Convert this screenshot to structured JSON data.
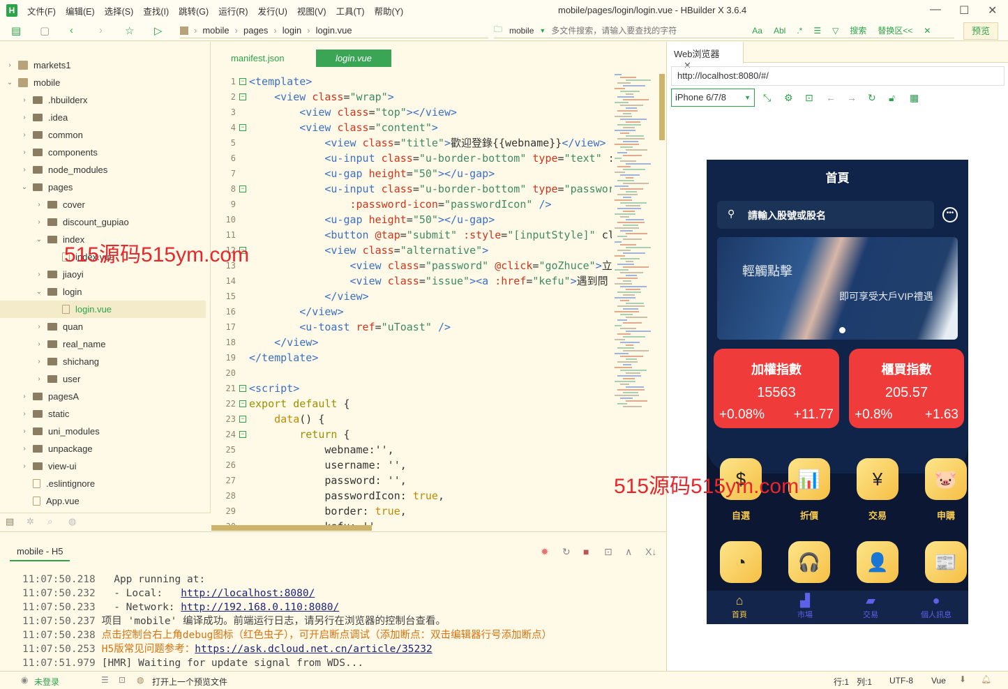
{
  "app": {
    "logo": "H",
    "title": "mobile/pages/login/login.vue - HBuilder X 3.6.4",
    "menu": [
      "文件(F)",
      "编辑(E)",
      "选择(S)",
      "查找(I)",
      "跳转(G)",
      "运行(R)",
      "发行(U)",
      "视图(V)",
      "工具(T)",
      "帮助(Y)"
    ]
  },
  "toolbar": {
    "breadcrumb": [
      "mobile",
      "pages",
      "login",
      "login.vue"
    ],
    "search_scope": "mobile",
    "search_placeholder": "多文件搜索，请输入要查找的字符",
    "search_label": "搜索",
    "replace_label": "替换区<<",
    "preview_label": "预览",
    "opt_case": "Aa",
    "opt_word": "Abl",
    "opt_regex": ".*"
  },
  "sidebar": {
    "items": [
      {
        "label": "markets1",
        "depth": 0,
        "type": "proj",
        "open": false
      },
      {
        "label": "mobile",
        "depth": 0,
        "type": "proj",
        "open": true
      },
      {
        "label": ".hbuilderx",
        "depth": 1,
        "type": "folder",
        "open": false
      },
      {
        "label": ".idea",
        "depth": 1,
        "type": "folder",
        "open": false
      },
      {
        "label": "common",
        "depth": 1,
        "type": "folder",
        "open": false
      },
      {
        "label": "components",
        "depth": 1,
        "type": "folder",
        "open": false
      },
      {
        "label": "node_modules",
        "depth": 1,
        "type": "folder",
        "open": false
      },
      {
        "label": "pages",
        "depth": 1,
        "type": "folder",
        "open": true
      },
      {
        "label": "cover",
        "depth": 2,
        "type": "folder",
        "open": false
      },
      {
        "label": "discount_gupiao",
        "depth": 2,
        "type": "folder",
        "open": false
      },
      {
        "label": "index",
        "depth": 2,
        "type": "folder",
        "open": true
      },
      {
        "label": "index.vue",
        "depth": 3,
        "type": "file"
      },
      {
        "label": "jiaoyi",
        "depth": 2,
        "type": "folder",
        "open": false
      },
      {
        "label": "login",
        "depth": 2,
        "type": "folder",
        "open": true
      },
      {
        "label": "login.vue",
        "depth": 3,
        "type": "file",
        "selected": true
      },
      {
        "label": "quan",
        "depth": 2,
        "type": "folder",
        "open": false
      },
      {
        "label": "real_name",
        "depth": 2,
        "type": "folder",
        "open": false
      },
      {
        "label": "shichang",
        "depth": 2,
        "type": "folder",
        "open": false
      },
      {
        "label": "user",
        "depth": 2,
        "type": "folder",
        "open": false
      },
      {
        "label": "pagesA",
        "depth": 1,
        "type": "folder",
        "open": false
      },
      {
        "label": "static",
        "depth": 1,
        "type": "folder",
        "open": false
      },
      {
        "label": "uni_modules",
        "depth": 1,
        "type": "folder",
        "open": false
      },
      {
        "label": "unpackage",
        "depth": 1,
        "type": "folder",
        "open": false
      },
      {
        "label": "view-ui",
        "depth": 1,
        "type": "folder",
        "open": false
      },
      {
        "label": ".eslintignore",
        "depth": 1,
        "type": "file"
      },
      {
        "label": "App.vue",
        "depth": 1,
        "type": "file"
      }
    ]
  },
  "editor": {
    "tabs": [
      {
        "label": "manifest.json",
        "active": false
      },
      {
        "label": "login.vue",
        "active": true
      }
    ],
    "fold_lines": [
      1,
      2,
      4,
      8,
      12,
      21,
      22,
      23,
      24
    ],
    "lines": [
      "<template>",
      "    <view class=\"wrap\">",
      "        <view class=\"top\"></view>",
      "        <view class=\"content\">",
      "            <view class=\"title\">歡迎登錄{{webname}}</view>",
      "            <u-input class=\"u-border-bottom\" type=\"text\" :",
      "            <u-gap height=\"50\"></u-gap>",
      "            <u-input class=\"u-border-bottom\" type=\"passwor",
      "                :password-icon=\"passwordIcon\" />",
      "            <u-gap height=\"50\"></u-gap>",
      "            <button @tap=\"submit\" :style=\"[inputStyle]\" cl",
      "            <view class=\"alternative\">",
      "                <view class=\"password\" @click=\"goZhuce\">立",
      "                <view class=\"issue\"><a :href=\"kefu\">遇到問",
      "            </view>",
      "        </view>",
      "        <u-toast ref=\"uToast\" />",
      "    </view>",
      "</template>",
      "",
      "<script>",
      "export default {",
      "    data() {",
      "        return {",
      "            webname:'',",
      "            username: '',",
      "            password: '',",
      "            passwordIcon: true,",
      "            border: true,",
      "            kefu: ''"
    ]
  },
  "watermark": "515源码515ym.com",
  "console": {
    "tab": "mobile - H5",
    "lines": [
      {
        "ts": "11:07:50.218",
        "text": "  App running at:"
      },
      {
        "ts": "11:07:50.232",
        "text": "  - Local:   ",
        "link": "http://localhost:8080/"
      },
      {
        "ts": "11:07:50.233",
        "text": "  - Network: ",
        "link": "http://192.168.0.110:8080/"
      },
      {
        "ts": "11:07:50.237",
        "text": "项目 'mobile' 编译成功。前端运行日志，请另行在浏览器的控制台查看。"
      },
      {
        "ts": "11:07:50.238",
        "text": "点击控制台右上角debug图标（红色虫子），可开启断点调试（添加断点：双击编辑器行号添加断点）",
        "warn": true
      },
      {
        "ts": "11:07:50.253",
        "text": "H5版常见问题参考：",
        "link": "https://ask.dcloud.net.cn/article/35232",
        "warn": true
      },
      {
        "ts": "11:07:51.979",
        "text": "[HMR] Waiting for update signal from WDS..."
      }
    ]
  },
  "browser": {
    "tab": "Web浏览器",
    "url": "http://localhost:8080/#/",
    "device": "iPhone 6/7/8"
  },
  "phone": {
    "title": "首頁",
    "search_placeholder": "請輸入股號或股名",
    "banner_text1": "輕觸點擊",
    "banner_text2": "即可享受大戶VIP禮遇",
    "cards": [
      {
        "title": "加權指數",
        "value": "15563",
        "pct": "+0.08%",
        "chg": "+11.77"
      },
      {
        "title": "櫃買指數",
        "value": "205.57",
        "pct": "+0.8%",
        "chg": "+1.63"
      }
    ],
    "grid": [
      {
        "label": "自選",
        "icon": "money-bag-icon",
        "glyph": "$"
      },
      {
        "label": "折價",
        "icon": "bar-chart-icon",
        "glyph": "📊"
      },
      {
        "label": "交易",
        "icon": "yen-exchange-icon",
        "glyph": "¥"
      },
      {
        "label": "申購",
        "icon": "piggy-bank-icon",
        "glyph": "🐷"
      },
      {
        "label": "",
        "icon": "pie-chart-icon",
        "glyph": "◔"
      },
      {
        "label": "",
        "icon": "customer-service-icon",
        "glyph": "🎧"
      },
      {
        "label": "",
        "icon": "user-icon",
        "glyph": "👤"
      },
      {
        "label": "",
        "icon": "news-icon",
        "glyph": "📰"
      }
    ],
    "nav": [
      {
        "label": "首頁",
        "icon": "home-icon",
        "glyph": "⌂",
        "active": true
      },
      {
        "label": "市場",
        "icon": "market-chart-icon",
        "glyph": "▟"
      },
      {
        "label": "交易",
        "icon": "wallet-icon",
        "glyph": "▰"
      },
      {
        "label": "個人訊息",
        "icon": "person-icon",
        "glyph": "●"
      }
    ],
    "colors": {
      "header": "#10244a",
      "card": "#ef3b3a",
      "gold": "#f6c94f",
      "nav_active": "#f6c94f",
      "nav": "#5d62e8"
    }
  },
  "statusbar": {
    "login": "未登录",
    "open_prev": "打开上一个预览文件",
    "row": "行:1",
    "col": "列:1",
    "encoding": "UTF-8",
    "lang": "Vue"
  }
}
